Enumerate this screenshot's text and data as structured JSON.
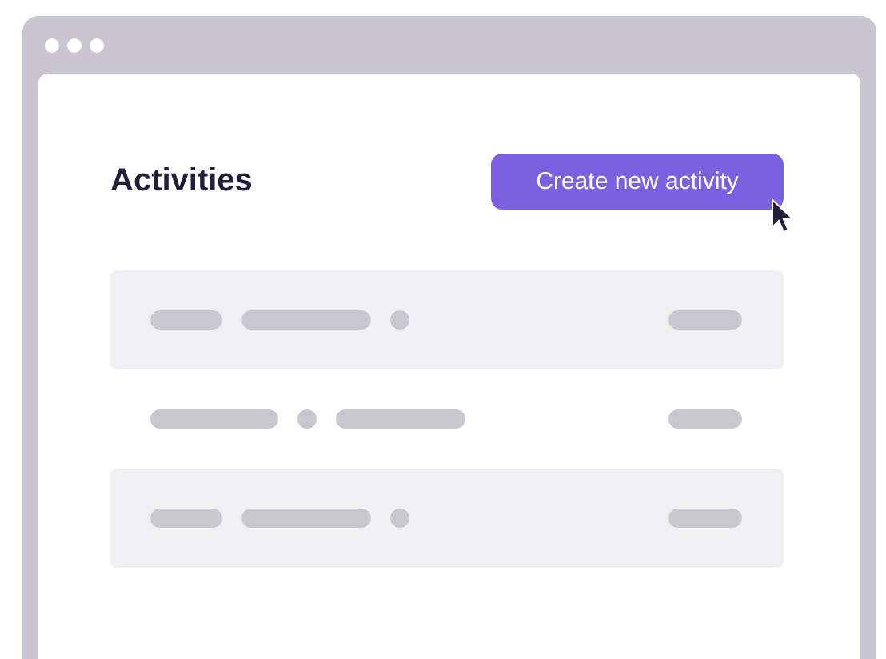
{
  "heading": "Activities",
  "button": {
    "label": "Create new activity"
  },
  "rows": [
    {
      "kind": "shaded"
    },
    {
      "kind": "plain"
    },
    {
      "kind": "shaded"
    }
  ]
}
